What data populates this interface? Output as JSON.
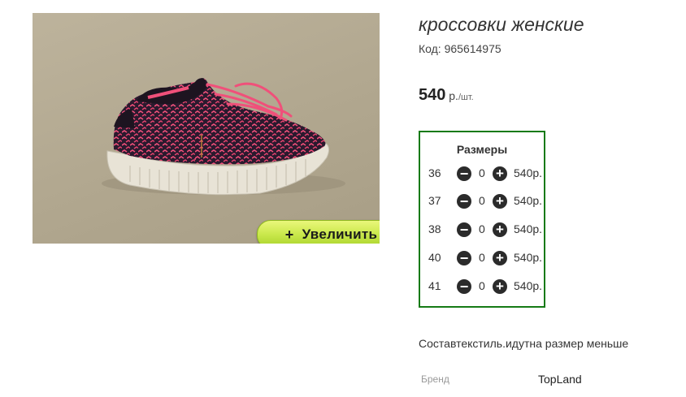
{
  "product": {
    "title": "кроссовки женские",
    "code": "Код: 965614975",
    "price_value": "540",
    "price_unit": " р.",
    "price_per": "/шт.",
    "zoom_plus": "+",
    "zoom_label": "Увеличить",
    "image_icon": "sneaker-product-photo"
  },
  "sizes": {
    "title": "Размеры",
    "rows": [
      {
        "size": "36",
        "qty": "0",
        "price": "540р."
      },
      {
        "size": "37",
        "qty": "0",
        "price": "540р."
      },
      {
        "size": "38",
        "qty": "0",
        "price": "540р."
      },
      {
        "size": "40",
        "qty": "0",
        "price": "540р."
      },
      {
        "size": "41",
        "qty": "0",
        "price": "540р."
      }
    ],
    "minus_symbol": "−",
    "plus_symbol": "+"
  },
  "composition": "Составтекстиль.идутна размер меньше",
  "brand": {
    "label": "Бренд",
    "value": "TopLand"
  },
  "colors": {
    "box_border": "#157a15",
    "button_green": "#c9e84b",
    "shoe_pink": "#f0507a",
    "shoe_dark": "#2a1a2e"
  }
}
